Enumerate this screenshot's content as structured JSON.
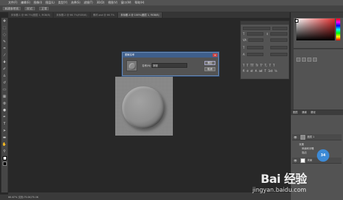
{
  "menubar": {
    "items": [
      "文件(F)",
      "编辑(E)",
      "图像(I)",
      "图层(L)",
      "类型(Y)",
      "选择(S)",
      "滤镜(T)",
      "3D(D)",
      "视图(V)",
      "窗口(W)",
      "帮助(H)"
    ]
  },
  "options": {
    "chip1": "新建参考线",
    "chip2": "样式:",
    "chip3": "正常"
  },
  "tabs": [
    {
      "label": "未标题-1 @ 66.7%(图层 1, RGB/8)",
      "active": false
    },
    {
      "label": "未标题-2 @ 66.7%(RGB/8)",
      "active": false
    },
    {
      "label": "素材.psd @ 66.7%",
      "active": false
    },
    {
      "label": "未标题-4 @ 100%(图层 1, RGB/8)",
      "active": true
    }
  ],
  "dialog": {
    "title": "图案名称",
    "name_label": "名称(N):",
    "name_value": "按钮",
    "ok_label": "确定",
    "cancel_label": "取消",
    "close_glyph": "×"
  },
  "char_panel": {
    "row_labels": [
      "T",
      "↕",
      "VA",
      "T",
      "A"
    ],
    "styles1": [
      "T",
      "T",
      "TT",
      "Tr",
      "T'",
      "T,",
      "T",
      "T"
    ],
    "styles2": [
      "fi",
      "σ",
      "st",
      "A",
      "ad",
      "T",
      "1st",
      "½"
    ]
  },
  "layers_panel": {
    "tabs": [
      "图层",
      "通道",
      "路径"
    ],
    "rows": [
      {
        "name": "图层 1",
        "top": 0
      },
      {
        "name": "背景",
        "top": 0
      }
    ],
    "sub_items": [
      "效果",
      "斜面和浮雕",
      "描边"
    ]
  },
  "badge": "34",
  "watermark": {
    "logo": "Bai 经验",
    "url": "jingyan.baidu.com"
  },
  "status": "66.67%    文档:75.0K/75.0K"
}
